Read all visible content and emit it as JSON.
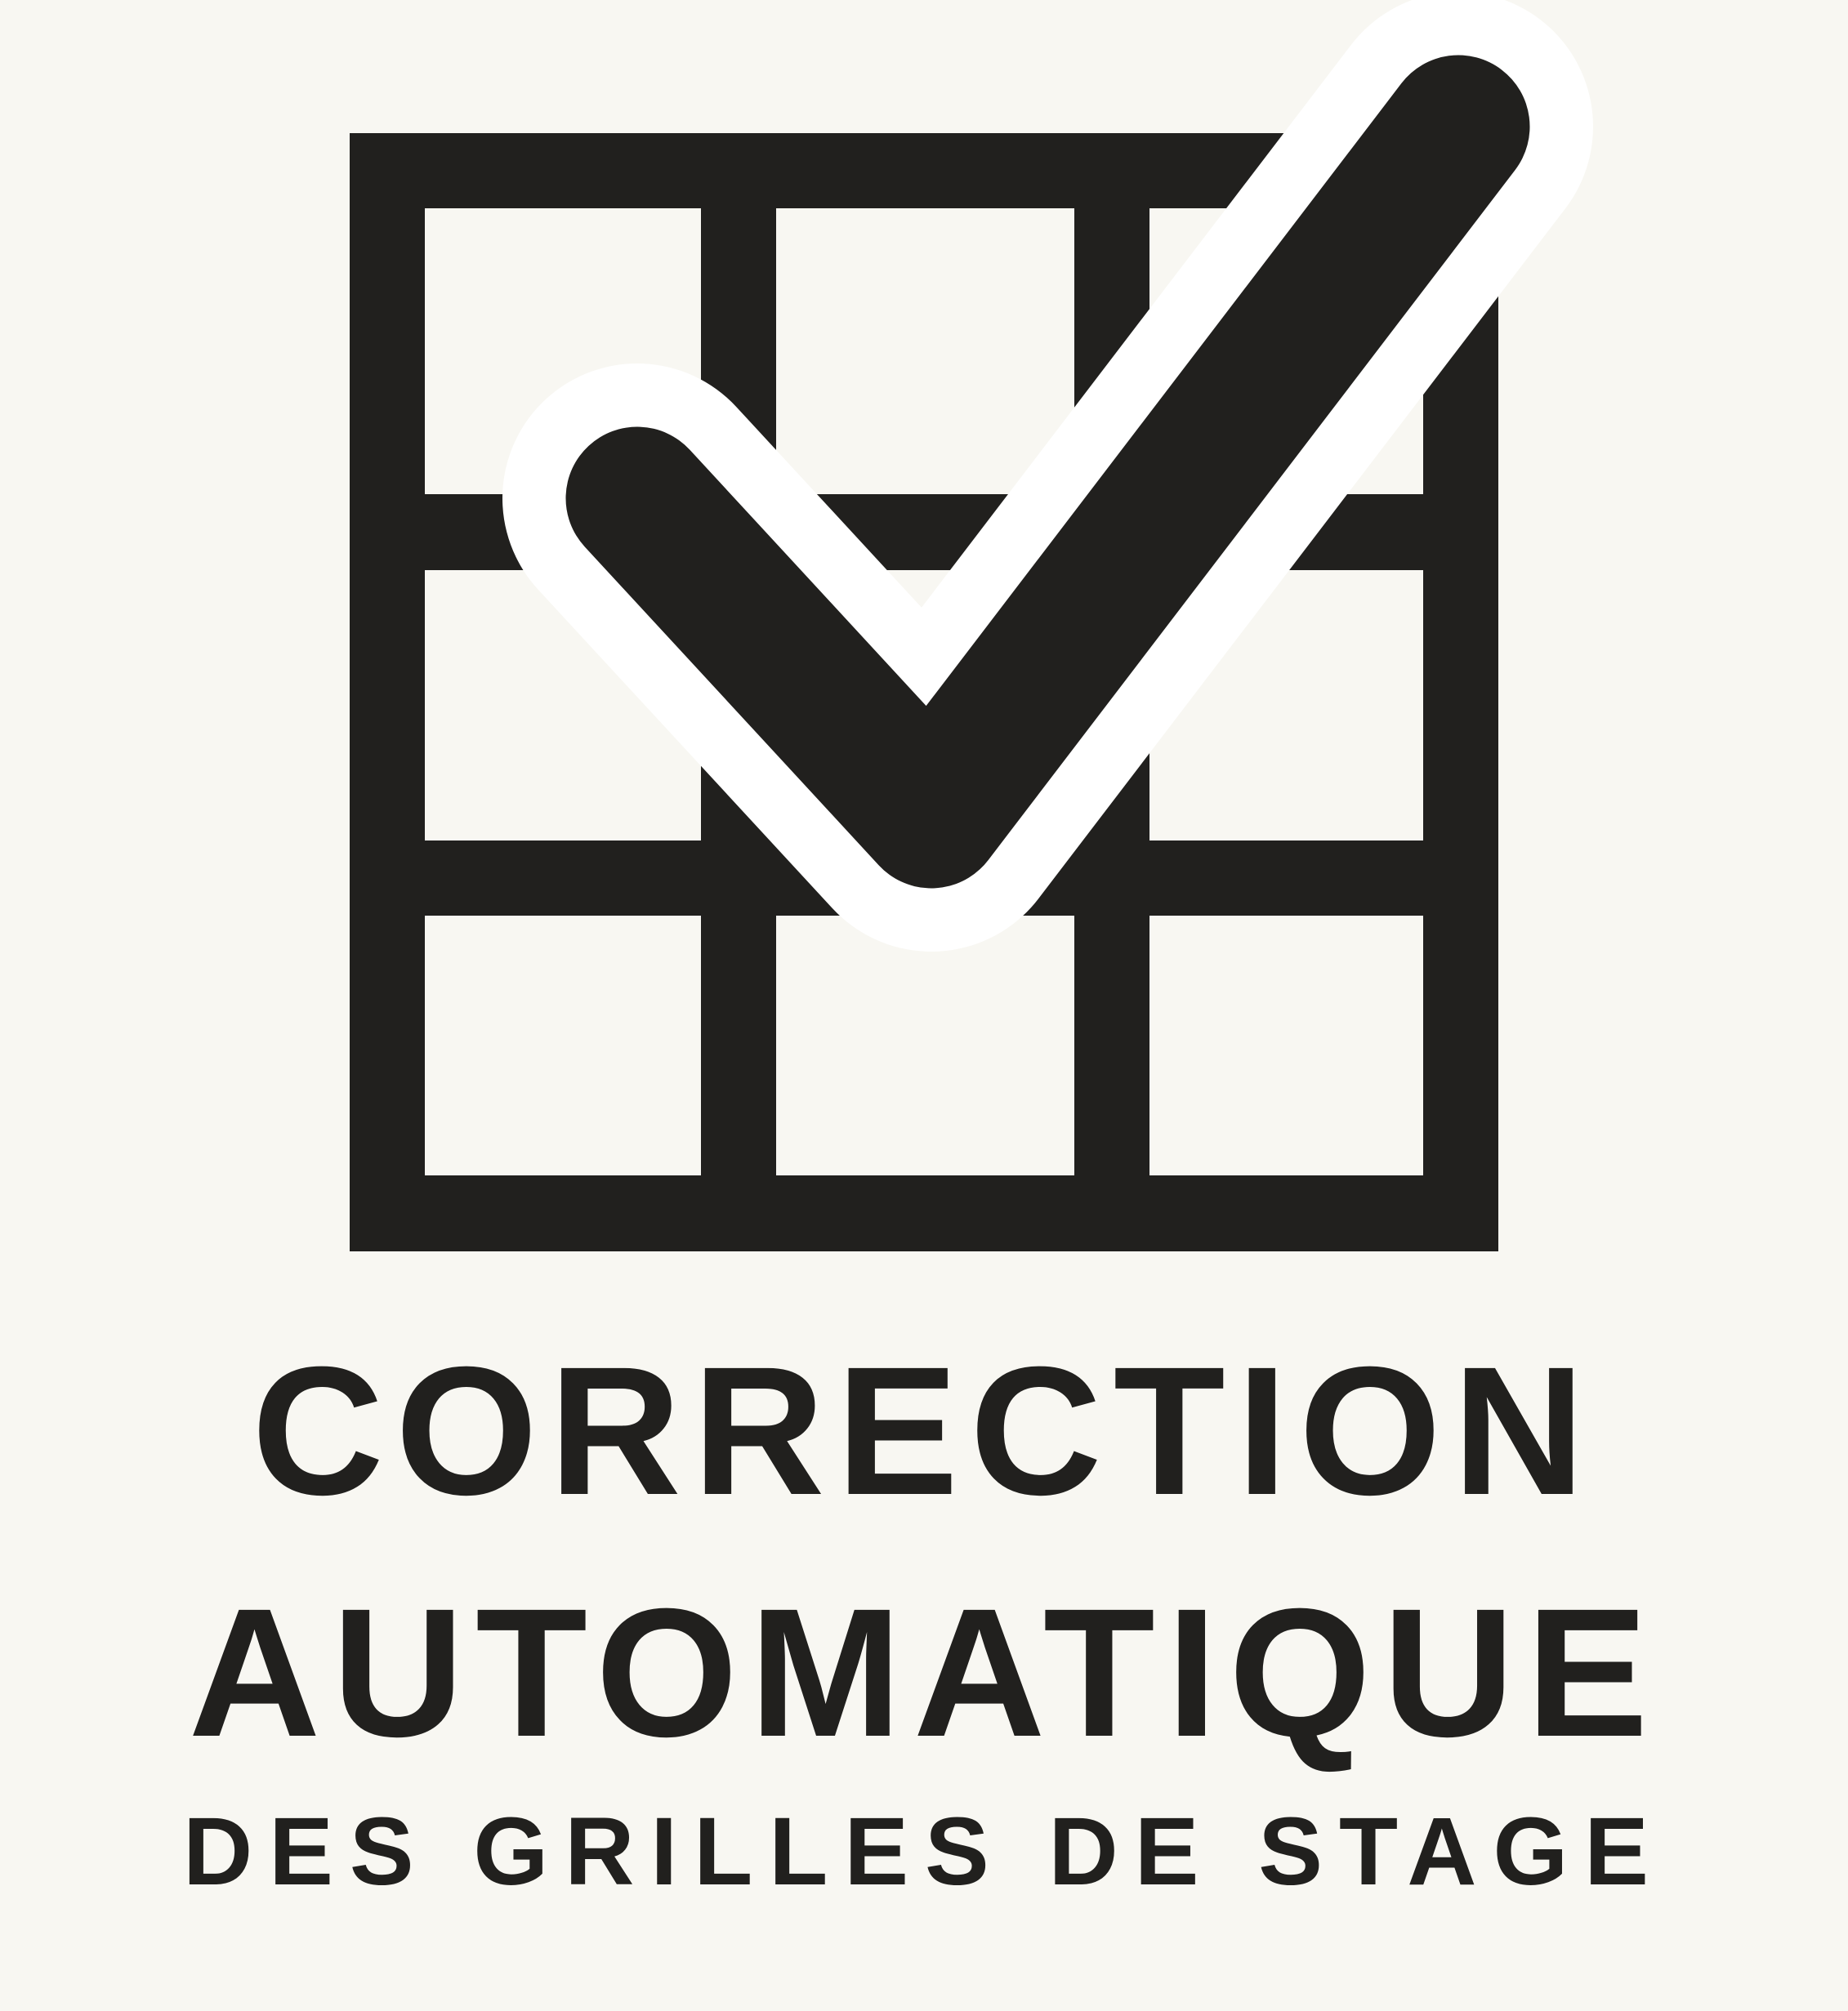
{
  "logo": {
    "title_line_1": "CORRECTION",
    "title_line_2": "AUTOMATIQUE",
    "subtitle": "DES GRILLES DE STAGE",
    "icon": "grid-checkmark-icon",
    "colors": {
      "background": "#f8f7f2",
      "ink": "#21201e",
      "halo": "#ffffff"
    }
  }
}
